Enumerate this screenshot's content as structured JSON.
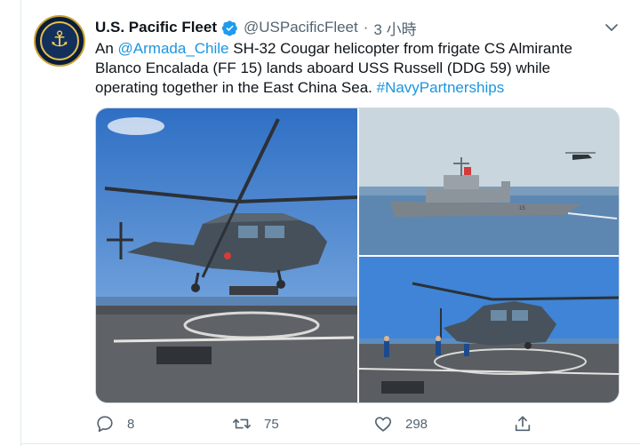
{
  "tweet": {
    "author_name": "U.S. Pacific Fleet",
    "handle": "@USPacificFleet",
    "separator": "·",
    "time": "3 小時",
    "text": {
      "prefix": "An ",
      "mention": "@Armada_Chile",
      "body": " SH-32 Cougar helicopter from frigate CS Almirante Blanco Encalada (FF 15) lands aboard USS Russell (DDG 59) while operating together in the East China Sea. ",
      "hashtag": "#NavyPartnerships"
    },
    "avatar": {
      "icon": "anchor-icon",
      "lettering": "COMMANDER · UNITED STATES PACIFIC FLEET"
    },
    "media": [
      {
        "description_icon": "helicopter-landing-photo"
      },
      {
        "description_icon": "frigate-at-sea-photo"
      },
      {
        "description_icon": "helicopter-on-deck-photo"
      }
    ]
  },
  "actions": {
    "reply_count": "8",
    "retweet_count": "75",
    "like_count": "298",
    "share_icon": "share-icon"
  },
  "colors": {
    "link": "#1b95e0",
    "verified": "#1d9bf0",
    "muted": "#536471",
    "text": "#0f1419"
  }
}
